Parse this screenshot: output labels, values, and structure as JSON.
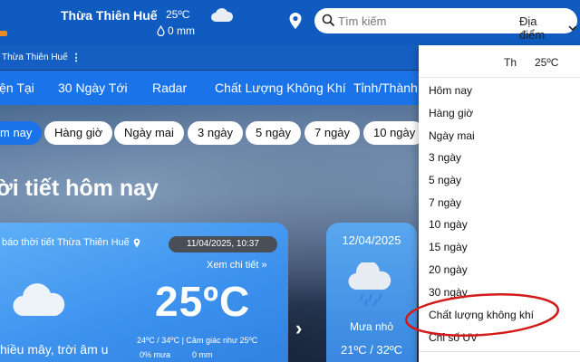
{
  "header": {
    "location": "Thừa Thiên Huế",
    "temperature": "25ºC",
    "rainfall": "0 mm",
    "search_placeholder": "Tìm kiếm",
    "location_select": "Địa điểm"
  },
  "breadcrumb": {
    "text": "Thừa Thiên Huế",
    "menu": "⋮"
  },
  "nav": [
    "iện Tại",
    "30 Ngày Tới",
    "Radar",
    "Chất Lượng Không Khí",
    "Tỉnh/Thành"
  ],
  "period_tabs": [
    "m nay",
    "Hàng giờ",
    "Ngày mai",
    "3 ngày",
    "5 ngày",
    "7 ngày",
    "10 ngày"
  ],
  "hero_title": "ời tiết hôm nay",
  "current": {
    "title": "báo thời tiết Thừa Thiên Huế",
    "datetime": "11/04/2025, 10:37",
    "see_detail": "Xem chi tiết »",
    "temperature": "25ºC",
    "description": "hiều mây, trời âm u",
    "range_text": "24ºC / 34ºC | Cảm giác như 25ºC",
    "rain_chance": "0% mưa",
    "rain_amount": "0 mm",
    "next_arrow": "›"
  },
  "forecast_card": {
    "date": "12/04/2025",
    "description": "Mưa nhỏ",
    "range": "21ºC / 32ºC"
  },
  "dropdown": {
    "head_city": "Th",
    "head_temp": "25ºC",
    "items": [
      "Hôm nay",
      "Hàng giờ",
      "Ngày mai",
      "3 ngày",
      "5 ngày",
      "7 ngày",
      "10 ngày",
      "15 ngày",
      "20 ngày",
      "30 ngày",
      "Chất lượng không khí",
      "Chỉ số UV"
    ]
  },
  "colors": {
    "primary": "#1a73e8",
    "header": "#0f5bc0",
    "annotation": "#d31a1a"
  }
}
